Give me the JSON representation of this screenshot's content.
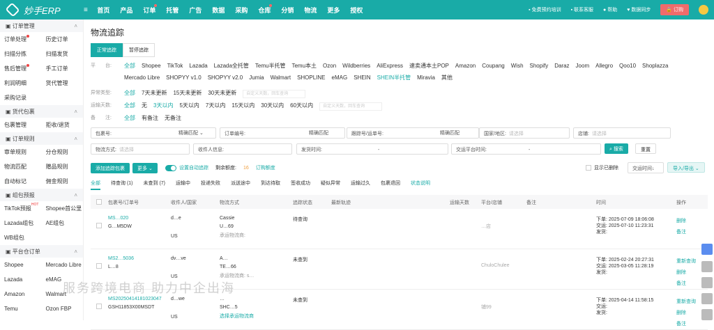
{
  "topbar": {
    "logo": "妙手ERP",
    "nav": [
      "首页",
      "产品",
      "订单",
      "托管",
      "广告",
      "数据",
      "采购",
      "仓库",
      "分销",
      "物流",
      "更多",
      "授权"
    ],
    "right": [
      "免费预约培训",
      "联系客服",
      "帮助",
      "数据同步"
    ],
    "buy": "订购"
  },
  "sidebar": [
    {
      "title": "订单管理",
      "items": [
        "订单处理",
        "历史订单",
        "扫描分拣",
        "扫描发货",
        "售后管理",
        "手工订单",
        "利润明细",
        "货代管理",
        "采购记录"
      ]
    },
    {
      "title": "货代包裹",
      "items": [
        "包裹管理",
        "拒收/退货"
      ]
    },
    {
      "title": "订单规则",
      "items": [
        "审单规则",
        "分仓规则",
        "物流匹配",
        "赠品规则",
        "自动标记",
        "佣金规则"
      ]
    },
    {
      "title": "组包预报",
      "items": [
        "TikTok预报",
        "Shopee首公里",
        "Lazada组包",
        "AE组包",
        "WB组包"
      ],
      "hot": "HOT"
    },
    {
      "title": "平台仓订单",
      "items": [
        "Shopee",
        "Mercado Libre",
        "Lazada",
        "eMAG",
        "Amazon",
        "Walmart",
        "Temu",
        "Ozon FBP"
      ]
    }
  ],
  "page": {
    "title": "物流追踪",
    "tabs": [
      "正常追踪",
      "暂停追踪"
    ]
  },
  "filters": {
    "platform": {
      "label": "平　　台:",
      "options": [
        "全部",
        "Shopee",
        "TikTok",
        "Lazada",
        "Lazada全托管",
        "Temu半托管",
        "Temu本土",
        "Ozon",
        "Wildberries",
        "AliExpress",
        "速卖通本土POP",
        "Amazon",
        "Coupang",
        "Wish",
        "Shopify",
        "Daraz",
        "Joom",
        "Allegro",
        "Qoo10",
        "Shoplazza",
        "Mercado Libre",
        "SHOPYY v1.0",
        "SHOPYY v2.0",
        "Jumia",
        "Walmart",
        "SHOPLINE",
        "eMAG",
        "SHEIN",
        "SHEIN半托管",
        "Miravia",
        "其他"
      ]
    },
    "exception": {
      "label": "异常类型:",
      "options": [
        "全部",
        "7天未更新",
        "15天未更新",
        "30天未更新"
      ],
      "placeholder": "自定义天数，回车查询"
    },
    "days": {
      "label": "运输天数:",
      "options": [
        "全部",
        "无",
        "3天以内",
        "5天以内",
        "7天以内",
        "15天以内",
        "30天以内",
        "60天以内"
      ],
      "placeholder": "自定义天数，回车查询"
    },
    "remark": {
      "label": "备　　注:",
      "options": [
        "全部",
        "有备注",
        "无备注"
      ]
    }
  },
  "search": {
    "package": "包裹号:",
    "match1": "精确匹配",
    "order": "订单编号:",
    "match2": "精确匹配",
    "tracking": "跟踪号/运单号:",
    "match3": "精确匹配",
    "country": "国家/地区:",
    "country_ph": "请选择",
    "shop": "店铺:",
    "shop_ph": "请选择",
    "method": "物流方式:",
    "method_ph": "请选择",
    "receiver": "收件人信息:",
    "ship_time": "发货时间:",
    "platform_time": "交运平台时间:",
    "dash": "-",
    "search_btn": "搜索",
    "reset": "重置"
  },
  "toolbar": {
    "add": "添加追踪包裹",
    "more": "更多",
    "auto": "设置自动追踪",
    "quota_label": "剩余额度:",
    "quota": "16",
    "buy_quota": "订购额度",
    "show_deleted": "显示已删除",
    "sort": "交运时间↓",
    "import": "导入/导出"
  },
  "status_tabs": [
    "全部",
    "待查询 (1)",
    "未查到 (7)",
    "运输中",
    "投递失败",
    "派送途中",
    "到达待取",
    "签收成功",
    "疑似异常",
    "运输过久",
    "包裹退回",
    "状态说明"
  ],
  "table": {
    "headers": [
      "包裹号/订单号",
      "收件人/国家",
      "物流方式",
      "追踪状态",
      "最新轨迹",
      "运输天数",
      "平台/店铺",
      "备注",
      "时间",
      "操作"
    ],
    "rows": [
      {
        "pkg": "MS…020",
        "order": "G…M5DW",
        "recv": "d…e",
        "country": "US",
        "method": "Cassie",
        "track": "U…69",
        "carrier": "承运物流商:",
        "status": "待查询",
        "shop": "…店",
        "times": [
          "下单: 2025-07-09 18:06:08",
          "交运: 2025-07-10 11:23:31",
          "发货:"
        ],
        "ops": [
          "删除",
          "备注"
        ]
      },
      {
        "pkg": "MS2…5036",
        "order": "L…8",
        "recv": "dv…ve",
        "country": "US",
        "method": "A…",
        "track": "TE…66",
        "carrier": "承运物流商: s…",
        "status": "未查到",
        "shop": "ChuloChulee",
        "times": [
          "下单: 2025-02-24 20:27:31",
          "交运: 2025-03-05 11:28:19",
          "发货:"
        ],
        "ops": [
          "重新查询",
          "删除",
          "备注"
        ]
      },
      {
        "pkg": "MS20250414181023047",
        "order": "GSH11853X00MSDT",
        "recv": "d…we",
        "country": "US",
        "method": "…",
        "track": "SHC…5",
        "carrier": "选择承运物流商",
        "status": "未查到",
        "shop": "铺99",
        "times": [
          "下单: 2025-04-14 11:58:15",
          "交运:",
          "发货:"
        ],
        "ops": [
          "重新查询",
          "删除",
          "备注"
        ]
      }
    ]
  },
  "watermark": "服务跨境电商 助力中企出海"
}
